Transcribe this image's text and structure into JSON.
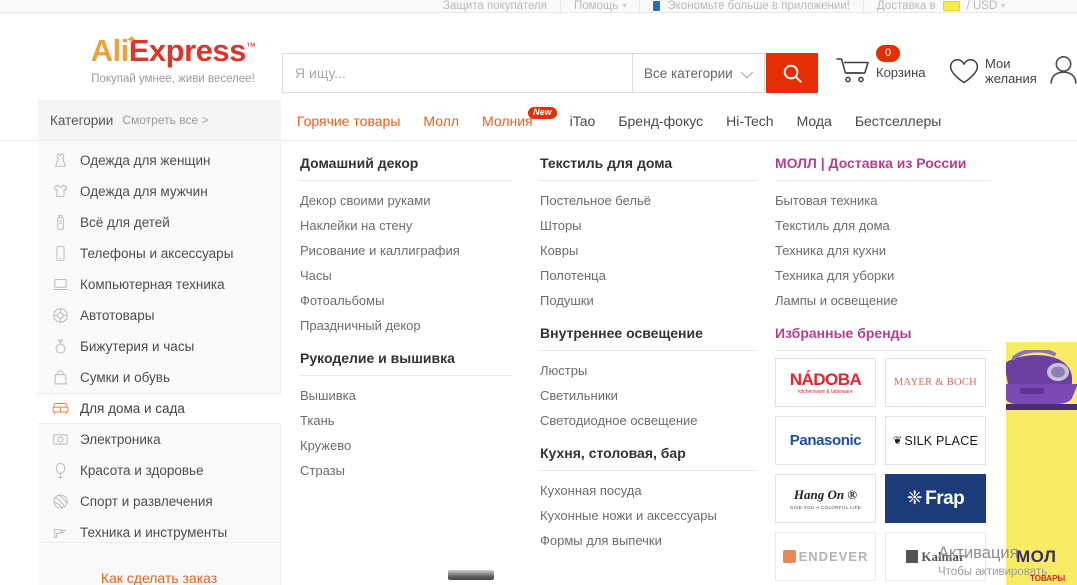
{
  "topbar": {
    "items": [
      {
        "label": "Защита покупателя",
        "caret": false,
        "icon": null
      },
      {
        "label": "Помощь",
        "caret": true,
        "icon": null
      },
      {
        "label": "Экономьте больше в приложении!",
        "caret": false,
        "icon": "mobile-phone-icon"
      },
      {
        "label": "Доставка в",
        "caret": true,
        "icon": "flag-icon",
        "suffix": "/ USD"
      }
    ]
  },
  "header": {
    "logo": {
      "part1": "Ali",
      "part2": "Express",
      "tm": "™"
    },
    "slogan": "Покупай умнее, живи веселее!",
    "search": {
      "value": "",
      "placeholder": "Я ищу..."
    },
    "category_select": {
      "label": "Все категории"
    },
    "search_button": {
      "icon": "search-icon"
    },
    "cart": {
      "label": "Корзина",
      "count": "0",
      "icon": "cart-icon"
    },
    "wishlist": {
      "label_line1": "Мои",
      "label_line2": "желания",
      "icon": "heart-icon"
    },
    "account": {
      "icon": "user-account-icon"
    }
  },
  "nav": {
    "items": [
      {
        "label": "Горячие товары",
        "accent": true,
        "badge": null
      },
      {
        "label": "Молл",
        "accent": true,
        "badge": null
      },
      {
        "label": "Молния",
        "accent": true,
        "badge": "New"
      },
      {
        "label": "iTao",
        "accent": false,
        "badge": null
      },
      {
        "label": "Бренд-фокус",
        "accent": false,
        "badge": null
      },
      {
        "label": "Hi-Tech",
        "accent": false,
        "badge": null
      },
      {
        "label": "Мода",
        "accent": false,
        "badge": null
      },
      {
        "label": "Бестселлеры",
        "accent": false,
        "badge": null
      }
    ]
  },
  "sidebar": {
    "title": "Категории",
    "see_all": "Смотреть все >",
    "footer_link": "Как сделать заказ",
    "items": [
      {
        "label": "Одежда для женщин",
        "icon": "dress-icon",
        "active": false
      },
      {
        "label": "Одежда для мужчин",
        "icon": "tshirt-icon",
        "active": false
      },
      {
        "label": "Всё для детей",
        "icon": "baby-bottle-icon",
        "active": false
      },
      {
        "label": "Телефоны и аксессуары",
        "icon": "phone-icon",
        "active": false
      },
      {
        "label": "Компьютерная техника",
        "icon": "laptop-icon",
        "active": false
      },
      {
        "label": "Автотовары",
        "icon": "wheel-icon",
        "active": false
      },
      {
        "label": "Бижутерия и часы",
        "icon": "ring-icon",
        "active": false
      },
      {
        "label": "Сумки и обувь",
        "icon": "bag-icon",
        "active": false
      },
      {
        "label": "Для дома и сада",
        "icon": "sofa-icon",
        "active": true
      },
      {
        "label": "Электроника",
        "icon": "camera-icon",
        "active": false
      },
      {
        "label": "Красота и здоровье",
        "icon": "mirror-icon",
        "active": false
      },
      {
        "label": "Спорт и развлечения",
        "icon": "ball-icon",
        "active": false
      },
      {
        "label": "Техника и инструменты",
        "icon": "drill-icon",
        "active": false
      }
    ]
  },
  "flyout": {
    "columns": [
      {
        "groups": [
          {
            "title": "Домашний декор",
            "style": "plain",
            "links": [
              "Декор своими руками",
              "Наклейки на стену",
              "Рисование и каллиграфия",
              "Часы",
              "Фотоальбомы",
              "Праздничный декор"
            ]
          },
          {
            "title": "Рукоделие и вышивка",
            "style": "plain",
            "links": [
              "Вышивка",
              "Ткань",
              "Кружево",
              "Стразы"
            ]
          }
        ]
      },
      {
        "groups": [
          {
            "title": "Текстиль для дома",
            "style": "plain",
            "links": [
              "Постельное бельё",
              "Шторы",
              "Ковры",
              "Полотенца",
              "Подушки"
            ]
          },
          {
            "title": "Внутреннее освещение",
            "style": "plain",
            "links": [
              "Люстры",
              "Светильники",
              "Светодиодное освещение"
            ]
          },
          {
            "title": "Кухня, столовая, бар",
            "style": "plain",
            "links": [
              "Кухонная посуда",
              "Кухонные ножи и аксессуары",
              "Формы для выпечки"
            ]
          }
        ]
      },
      {
        "groups": [
          {
            "title": "МОЛЛ | Доставка из России",
            "style": "mall",
            "links": [
              "Бытовая техника",
              "Текстиль для дома",
              "Техника для кухни",
              "Техника для уборки",
              "Лампы и освещение"
            ]
          }
        ],
        "brands_title": "Избранные бренды",
        "brands": [
          {
            "name": "NÁDOBA",
            "tagline": "kitchenware & tableware",
            "style": "nadoba"
          },
          {
            "name": "MAYER & BOCH",
            "tagline": "",
            "style": "mayer"
          },
          {
            "name": "Panasonic",
            "tagline": "",
            "style": "panasonic"
          },
          {
            "name": "SILK PLACE",
            "tagline": "",
            "style": "silk"
          },
          {
            "name": "Hang On",
            "tagline": "GIVE YOU A COLORFUL LIFE",
            "style": "hangon"
          },
          {
            "name": "Frap",
            "tagline": "",
            "style": "frap"
          },
          {
            "name": "ENDEVER",
            "tagline": "",
            "style": "endever"
          },
          {
            "name": "Kalmar",
            "tagline": "",
            "style": "kalmar"
          }
        ]
      }
    ]
  },
  "promo": {
    "headline": "МОЛ",
    "sub": "ТОВАРЫ",
    "image": "purple-iron-image"
  },
  "watermark": {
    "title": "Активация",
    "subtitle": "Чтобы активировать"
  },
  "colors": {
    "accent_red": "#e62e04",
    "accent_orange": "#e8601c",
    "mall_purple": "#b0418e",
    "logo_orange": "#e8a33d",
    "logo_red": "#d8372a",
    "promo_yellow": "#f7ec63"
  }
}
